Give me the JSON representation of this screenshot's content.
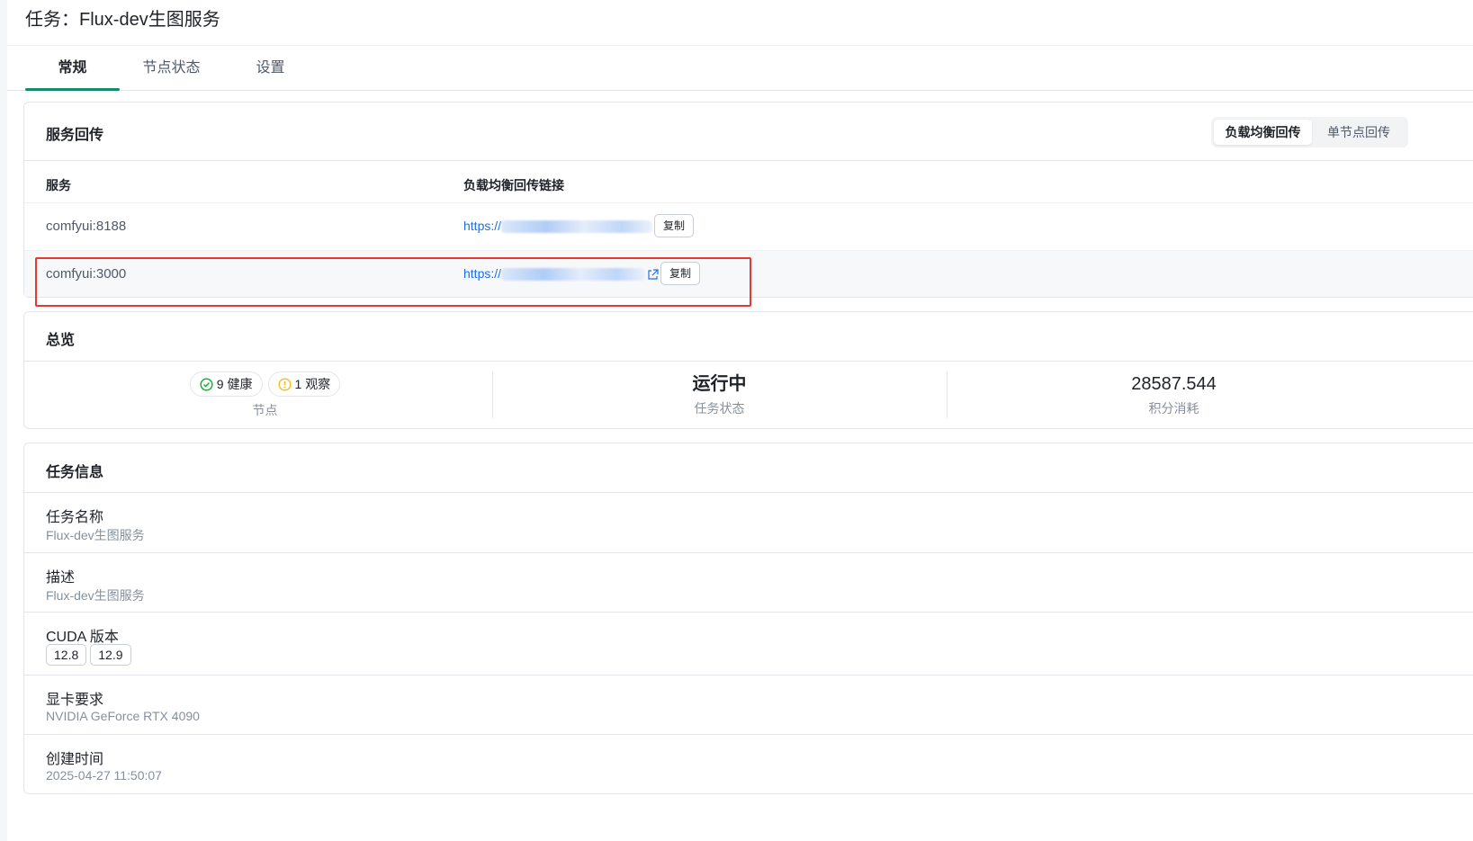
{
  "page": {
    "title": "任务：Flux-dev生图服务"
  },
  "tabs": [
    {
      "label": "常规",
      "active": true
    },
    {
      "label": "节点状态",
      "active": false
    },
    {
      "label": "设置",
      "active": false
    }
  ],
  "service_return": {
    "title": "服务回传",
    "segment": {
      "options": [
        "负载均衡回传",
        "单节点回传"
      ],
      "selected": "负载均衡回传"
    },
    "columns": [
      "服务",
      "负载均衡回传链接"
    ],
    "rows": [
      {
        "service": "comfyui:8188",
        "link_prefix": "https://",
        "copy_label": "复制"
      },
      {
        "service": "comfyui:3000",
        "link_prefix": "https://",
        "copy_label": "复制"
      }
    ]
  },
  "overview": {
    "title": "总览",
    "nodes": {
      "healthy_count": "9",
      "healthy_label": "健康",
      "watch_count": "1",
      "watch_label": "观察",
      "label": "节点"
    },
    "task_status": {
      "value": "运行中",
      "label": "任务状态"
    },
    "credits": {
      "value": "28587.544",
      "label": "积分消耗"
    }
  },
  "task_info": {
    "title": "任务信息",
    "name": {
      "label": "任务名称",
      "value": "Flux-dev生图服务"
    },
    "description": {
      "label": "描述",
      "value": "Flux-dev生图服务"
    },
    "cuda": {
      "label": "CUDA 版本",
      "versions": [
        "12.8",
        "12.9"
      ]
    },
    "gpu": {
      "label": "显卡要求",
      "value": "NVIDIA GeForce RTX 4090"
    },
    "created": {
      "label": "创建时间",
      "value": "2025-04-27 11:50:07"
    }
  },
  "colors": {
    "accent": "#168a6e",
    "link": "#1d6fe8",
    "healthy": "#00b42a",
    "warning": "#f7ba1e",
    "highlight": "#e53935"
  },
  "icons": {
    "healthy": "check-circle-icon",
    "watch": "info-circle-icon",
    "external": "external-link-icon"
  }
}
